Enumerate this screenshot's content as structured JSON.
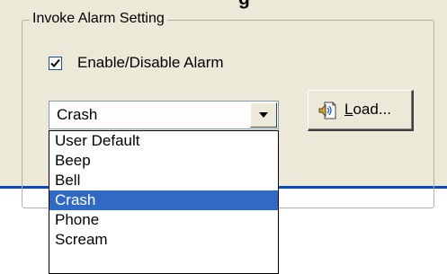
{
  "header": {
    "title_fragment": "g"
  },
  "group": {
    "legend": "Invoke Alarm Setting"
  },
  "alarm_checkbox": {
    "label": "Enable/Disable Alarm",
    "checked": true
  },
  "sound_select": {
    "value": "Crash",
    "options": [
      "User Default",
      "Beep",
      "Bell",
      "Crash",
      "Phone",
      "Scream"
    ],
    "selected_index": 3
  },
  "load_button": {
    "label_underlined": "L",
    "label_rest": "oad...",
    "icon": "speaker-file-icon"
  },
  "colors": {
    "selection": "#316ac5",
    "panel": "#ece9d8",
    "accent_line": "#0a49b8"
  }
}
